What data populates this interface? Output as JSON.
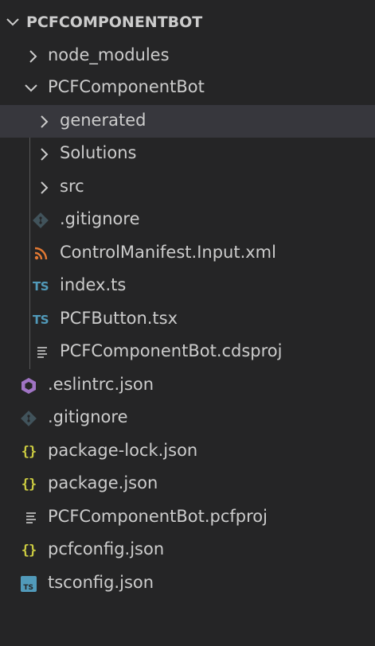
{
  "explorer": {
    "section_title": "PCFCOMPONENTBOT",
    "items": [
      {
        "label": "node_modules",
        "kind": "folder",
        "expanded": false,
        "depth": 1,
        "icon": "chevron-right-icon"
      },
      {
        "label": "PCFComponentBot",
        "kind": "folder",
        "expanded": true,
        "depth": 1,
        "icon": "chevron-down-icon"
      },
      {
        "label": "generated",
        "kind": "folder",
        "expanded": false,
        "depth": 2,
        "icon": "chevron-right-icon",
        "selected": true
      },
      {
        "label": "Solutions",
        "kind": "folder",
        "expanded": false,
        "depth": 2,
        "icon": "chevron-right-icon"
      },
      {
        "label": "src",
        "kind": "folder",
        "expanded": false,
        "depth": 2,
        "icon": "chevron-right-icon"
      },
      {
        "label": ".gitignore",
        "kind": "file",
        "depth": 2,
        "icon": "git-icon"
      },
      {
        "label": "ControlManifest.Input.xml",
        "kind": "file",
        "depth": 2,
        "icon": "rss-xml-icon"
      },
      {
        "label": "index.ts",
        "kind": "file",
        "depth": 2,
        "icon": "typescript-icon",
        "icon_text": "TS"
      },
      {
        "label": "PCFButton.tsx",
        "kind": "file",
        "depth": 2,
        "icon": "typescript-icon",
        "icon_text": "TS"
      },
      {
        "label": "PCFComponentBot.cdsproj",
        "kind": "file",
        "depth": 2,
        "icon": "lines-file-icon"
      },
      {
        "label": ".eslintrc.json",
        "kind": "file",
        "depth": 1,
        "icon": "eslint-icon"
      },
      {
        "label": ".gitignore",
        "kind": "file",
        "depth": 1,
        "icon": "git-icon"
      },
      {
        "label": "package-lock.json",
        "kind": "file",
        "depth": 1,
        "icon": "json-braces-icon",
        "icon_text": "{}"
      },
      {
        "label": "package.json",
        "kind": "file",
        "depth": 1,
        "icon": "json-braces-icon",
        "icon_text": "{}"
      },
      {
        "label": "PCFComponentBot.pcfproj",
        "kind": "file",
        "depth": 1,
        "icon": "lines-file-icon"
      },
      {
        "label": "pcfconfig.json",
        "kind": "file",
        "depth": 1,
        "icon": "json-braces-icon",
        "icon_text": "{}"
      },
      {
        "label": "tsconfig.json",
        "kind": "file",
        "depth": 1,
        "icon": "tsconfig-icon",
        "icon_text": "TS"
      }
    ]
  },
  "colors": {
    "background": "#252526",
    "selected_row": "#37373d",
    "text": "#cccccc",
    "typescript": "#519aba",
    "json": "#cbcb41",
    "xml": "#e37933",
    "eslint": "#a074c4",
    "git": "#41535b"
  }
}
